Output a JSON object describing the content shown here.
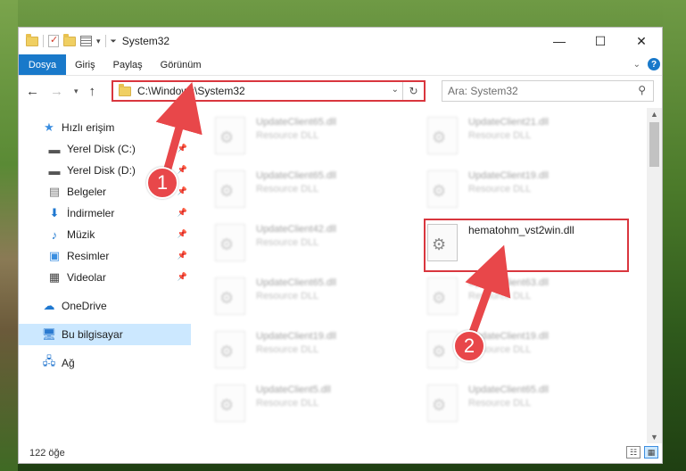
{
  "window": {
    "title": "System32"
  },
  "controls": {
    "minimize": "—",
    "maximize": "☐",
    "close": "✕"
  },
  "ribbon": {
    "tabs": [
      "Dosya",
      "Giriş",
      "Paylaş",
      "Görünüm"
    ]
  },
  "address": {
    "path": "C:\\Windows\\System32"
  },
  "search": {
    "placeholder": "Ara: System32"
  },
  "sidebar": {
    "quick_access": "Hızlı erişim",
    "items": [
      {
        "label": "Yerel Disk (C:)",
        "icon": "drive-icon"
      },
      {
        "label": "Yerel Disk (D:)",
        "icon": "drive-icon"
      },
      {
        "label": "Belgeler",
        "icon": "documents-icon"
      },
      {
        "label": "İndirmeler",
        "icon": "download-icon"
      },
      {
        "label": "Müzik",
        "icon": "music-icon"
      },
      {
        "label": "Resimler",
        "icon": "pictures-icon"
      },
      {
        "label": "Videolar",
        "icon": "video-icon"
      }
    ],
    "onedrive": "OneDrive",
    "this_pc": "Bu bilgisayar",
    "network": "Ağ"
  },
  "files": [
    {
      "name": "UpdateClient65.dll",
      "type": "Resource DLL"
    },
    {
      "name": "UpdateClient21.dll",
      "type": "Resource DLL"
    },
    {
      "name": "UpdateClient65.dll",
      "type": "Resource DLL"
    },
    {
      "name": "UpdateClient19.dll",
      "type": "Resource DLL"
    },
    {
      "name": "UpdateClient42.dll",
      "type": "Resource DLL"
    },
    {
      "name": "hematohm_vst2win.dll",
      "type": ""
    },
    {
      "name": "UpdateClient65.dll",
      "type": "Resource DLL"
    },
    {
      "name": "UpdateClient63.dll",
      "type": "Resource DLL"
    },
    {
      "name": "UpdateClient19.dll",
      "type": "Resource DLL"
    },
    {
      "name": "UpdateClient19.dll",
      "type": "Resource DLL"
    },
    {
      "name": "UpdateClient5.dll",
      "type": "Resource DLL"
    },
    {
      "name": "UpdateClient65.dll",
      "type": "Resource DLL"
    }
  ],
  "status": {
    "count": "122 öğe"
  },
  "annotations": {
    "step1": "1",
    "step2": "2",
    "color": "#e8474a"
  }
}
